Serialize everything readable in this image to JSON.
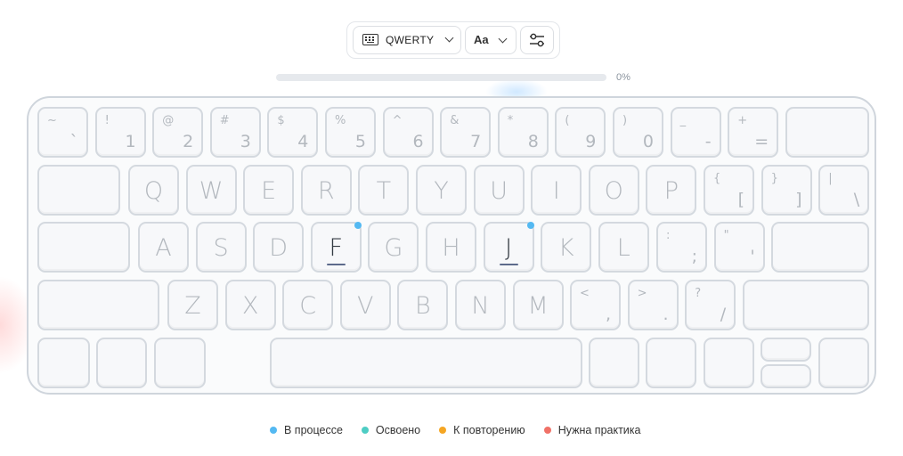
{
  "toolbar": {
    "layout_label": "QWERTY",
    "font_label": "Aa",
    "icons": {
      "layout": "keyboard-icon",
      "layout_dropdown": "chevron-down-icon",
      "font_dropdown": "chevron-down-icon",
      "settings": "sliders-icon"
    }
  },
  "progress": {
    "percent_label": "0%",
    "value": 0
  },
  "keyboard": {
    "home_row_keys": [
      "F",
      "J"
    ],
    "row_numbers": [
      {
        "shift": "~",
        "base": "`"
      },
      {
        "shift": "!",
        "base": "1"
      },
      {
        "shift": "@",
        "base": "2"
      },
      {
        "shift": "#",
        "base": "3"
      },
      {
        "shift": "$",
        "base": "4"
      },
      {
        "shift": "%",
        "base": "5"
      },
      {
        "shift": "^",
        "base": "6"
      },
      {
        "shift": "&",
        "base": "7"
      },
      {
        "shift": "*",
        "base": "8"
      },
      {
        "shift": "(",
        "base": "9"
      },
      {
        "shift": ")",
        "base": "0"
      },
      {
        "shift": "_",
        "base": "-"
      },
      {
        "shift": "+",
        "base": "="
      }
    ],
    "row_top": [
      "Q",
      "W",
      "E",
      "R",
      "T",
      "Y",
      "U",
      "I",
      "O",
      "P"
    ],
    "row_top_symbols": [
      {
        "shift": "{",
        "base": "["
      },
      {
        "shift": "}",
        "base": "]"
      },
      {
        "shift": "|",
        "base": "\\"
      }
    ],
    "row_home": [
      "A",
      "S",
      "D",
      "F",
      "G",
      "H",
      "J",
      "K",
      "L"
    ],
    "row_home_symbols": [
      {
        "shift": ":",
        "base": ";"
      },
      {
        "shift": "\"",
        "base": "'"
      }
    ],
    "row_bottom": [
      "Z",
      "X",
      "C",
      "V",
      "B",
      "N",
      "M"
    ],
    "row_bottom_symbols": [
      {
        "shift": "<",
        "base": ","
      },
      {
        "shift": ">",
        "base": "."
      },
      {
        "shift": "?",
        "base": "/"
      }
    ]
  },
  "legend": [
    {
      "label": "В процессе",
      "color": "#54b9f2"
    },
    {
      "label": "Освоено",
      "color": "#4ecdc4"
    },
    {
      "label": "К повторению",
      "color": "#f5a623"
    },
    {
      "label": "Нужна практика",
      "color": "#f07167"
    }
  ],
  "colors": {
    "key_border": "#d4d9df",
    "key_letter": "#b3b8be",
    "home_key_letter": "#333a42",
    "active_dot": "#54b9f2"
  }
}
